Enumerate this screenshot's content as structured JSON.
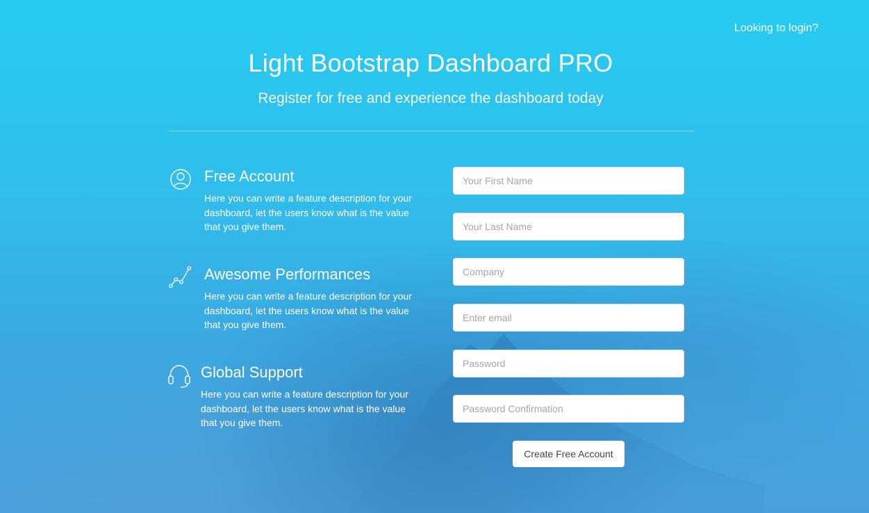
{
  "header": {
    "login_link": "Looking to login?",
    "title": "Light Bootstrap Dashboard PRO",
    "subtitle": "Register for free and experience the dashboard today"
  },
  "features": [
    {
      "icon": "user-circle-icon",
      "title": "Free Account",
      "description": "Here you can write a feature description for your dashboard, let the users know what is the value that you give them."
    },
    {
      "icon": "graph-line-icon",
      "title": "Awesome Performances",
      "description": "Here you can write a feature description for your dashboard, let the users know what is the value that you give them."
    },
    {
      "icon": "headset-icon",
      "title": "Global Support",
      "description": "Here you can write a feature description for your dashboard, let the users know what is the value that you give them."
    }
  ],
  "form": {
    "first_name_placeholder": "Your First Name",
    "last_name_placeholder": "Your Last Name",
    "company_placeholder": "Company",
    "email_placeholder": "Enter email",
    "password_placeholder": "Password",
    "password_confirm_placeholder": "Password Confirmation",
    "submit_label": "Create Free Account"
  },
  "footer": {
    "text": ""
  },
  "colors": {
    "background_top": "#27cbf0",
    "background_bottom": "#4a9fdb",
    "text": "#ffffff"
  }
}
